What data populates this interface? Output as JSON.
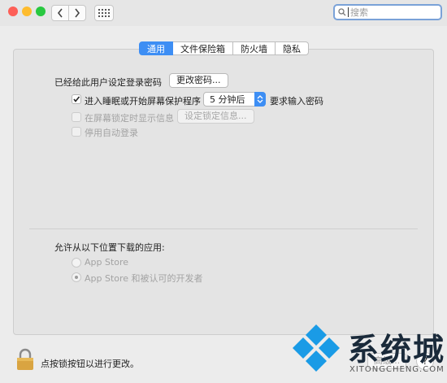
{
  "window": {
    "search": {
      "placeholder": "搜索"
    }
  },
  "tabs": [
    {
      "label": "通用",
      "active": true
    },
    {
      "label": "文件保险箱",
      "active": false
    },
    {
      "label": "防火墙",
      "active": false
    },
    {
      "label": "隐私",
      "active": false
    }
  ],
  "general": {
    "password_set_label": "已经给此用户设定登录密码",
    "change_password_button": "更改密码...",
    "require_password_label": "进入睡眠或开始屏幕保护程序",
    "require_password_checked": true,
    "delay_select_value": "5 分钟后",
    "require_password_suffix": "要求输入密码",
    "lock_message_label": "在屏幕锁定时显示信息",
    "lock_message_checked": false,
    "set_lock_message_button": "设定锁定信息...",
    "disable_autologin_label": "停用自动登录",
    "disable_autologin_checked": false
  },
  "download": {
    "heading": "允许从以下位置下载的应用:",
    "options": [
      {
        "label": "App Store",
        "selected": false
      },
      {
        "label": "App Store 和被认可的开发者",
        "selected": true
      }
    ]
  },
  "footer": {
    "lock_text": "点按锁按钮以进行更改。",
    "advanced_button": "高级...",
    "help_button": "?"
  },
  "watermark": {
    "title": "系统城",
    "url": "XITONGCHENG.COM"
  },
  "colors": {
    "accent": "#3d8ef4",
    "close": "#fd5f57",
    "minimize": "#febc2e",
    "zoom": "#28c840",
    "lock": "#d9a441"
  }
}
